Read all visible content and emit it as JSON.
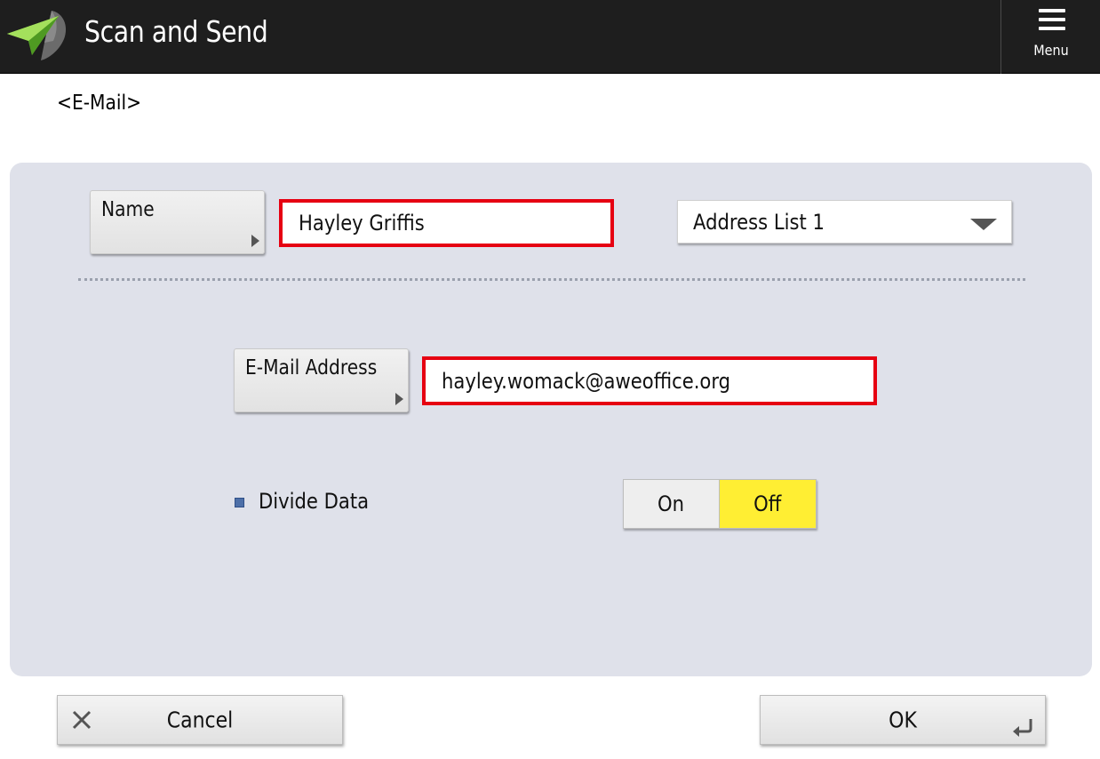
{
  "header": {
    "title": "Scan and Send",
    "menu_label": "Menu",
    "logo_icon": "paper-plane-icon",
    "background": "#1e1e1e"
  },
  "destination_type": "<E-Mail>",
  "form": {
    "name_button_label": "Name",
    "name_value": "Hayley Griffis",
    "address_list_selected": "Address List 1",
    "email_button_label": "E-Mail Address",
    "email_value": "hayley.womack@aweoffice.org",
    "divide_data_label": "Divide Data",
    "divide_data_options": [
      "On",
      "Off"
    ],
    "divide_data_selected": "Off",
    "highlight_color": "#e60012",
    "selected_option_color": "#ffee33",
    "panel_color": "#dfe1ea"
  },
  "footer": {
    "cancel_label": "Cancel",
    "ok_label": "OK"
  }
}
